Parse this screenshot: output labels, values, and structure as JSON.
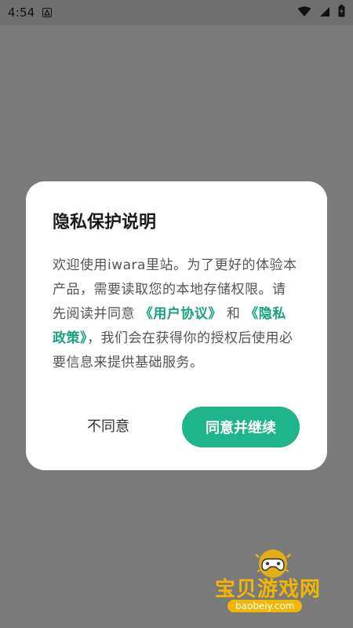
{
  "status_bar": {
    "time": "4:54"
  },
  "dialog": {
    "title": "隐私保护说明",
    "body_part1": "欢迎使用iwara里站。为了更好的体验本产品，需要读取您的本地存储权限。请先阅读并同意",
    "link_user_agreement": "《用户协议》",
    "body_and": "和",
    "link_privacy_policy": "《隐私政策》",
    "body_part2": "，我们会在获得你的授权后使用必要信息来提供基础服务。",
    "disagree_label": "不同意",
    "agree_label": "同意并继续"
  },
  "watermark": {
    "text": "宝贝游戏网",
    "url": "baobeiy.com"
  },
  "colors": {
    "accent": "#20b48b",
    "link": "#18a27f",
    "overlay": "#7a7a7a"
  }
}
